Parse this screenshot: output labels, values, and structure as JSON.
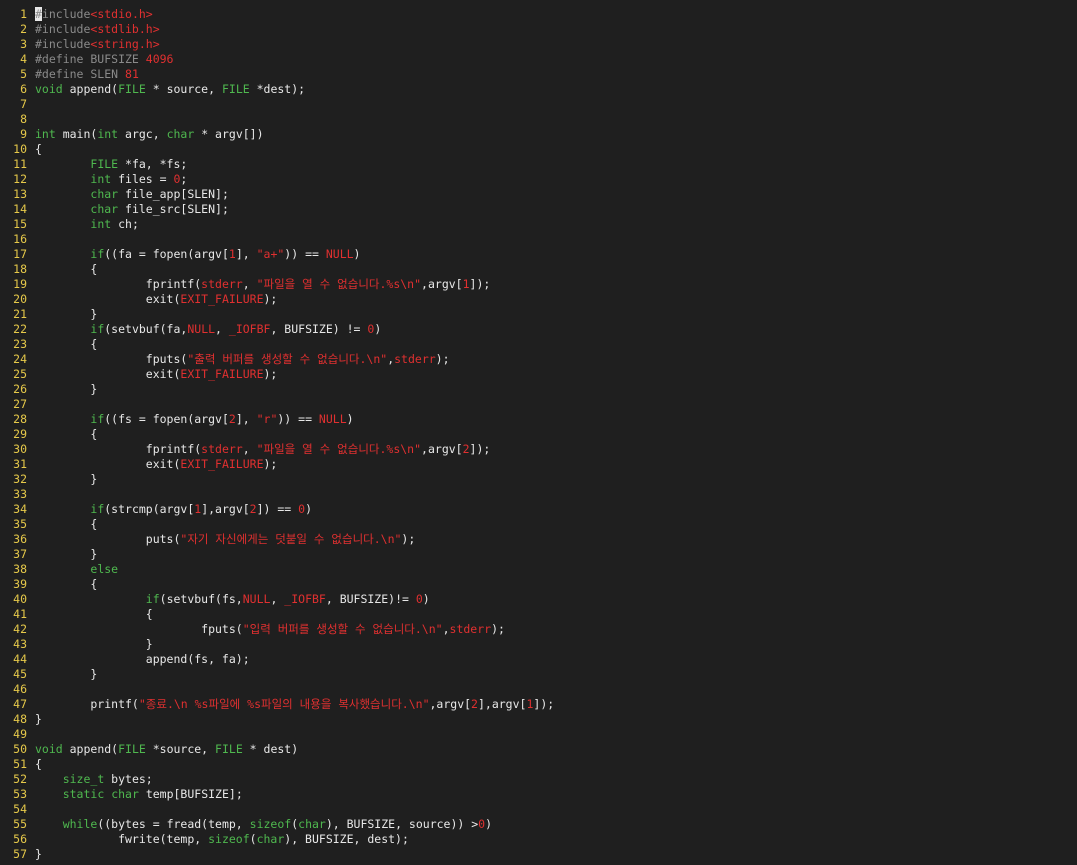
{
  "editor": {
    "cursor": {
      "line": 1,
      "col": 0
    },
    "colors": {
      "background": "#1f1f1f",
      "line_number": "#e6c94a",
      "plain": "#e8e8e8",
      "preprocessor": "#8a8a8a",
      "string_constant": "#e03030",
      "keyword_type": "#4fb84f"
    },
    "lines": [
      {
        "n": "1",
        "tokens": [
          [
            "pp",
            "#include"
          ],
          [
            "inc",
            "<stdio.h>"
          ]
        ]
      },
      {
        "n": "2",
        "tokens": [
          [
            "pp",
            "#include"
          ],
          [
            "inc",
            "<stdlib.h>"
          ]
        ]
      },
      {
        "n": "3",
        "tokens": [
          [
            "pp",
            "#include"
          ],
          [
            "inc",
            "<string.h>"
          ]
        ]
      },
      {
        "n": "4",
        "tokens": [
          [
            "pp",
            "#define BUFSIZE "
          ],
          [
            "num",
            "4096"
          ]
        ]
      },
      {
        "n": "5",
        "tokens": [
          [
            "pp",
            "#define SLEN "
          ],
          [
            "num",
            "81"
          ]
        ]
      },
      {
        "n": "6",
        "tokens": [
          [
            "kw",
            "void"
          ],
          [
            "plain",
            " append("
          ],
          [
            "type",
            "FILE"
          ],
          [
            "plain",
            " * source, "
          ],
          [
            "type",
            "FILE"
          ],
          [
            "plain",
            " *dest);"
          ]
        ]
      },
      {
        "n": "7",
        "tokens": []
      },
      {
        "n": "8",
        "tokens": []
      },
      {
        "n": "9",
        "tokens": [
          [
            "type",
            "int"
          ],
          [
            "plain",
            " main("
          ],
          [
            "type",
            "int"
          ],
          [
            "plain",
            " argc, "
          ],
          [
            "type",
            "char"
          ],
          [
            "plain",
            " * argv[])"
          ]
        ]
      },
      {
        "n": "10",
        "tokens": [
          [
            "plain",
            "{"
          ]
        ]
      },
      {
        "n": "11",
        "tokens": [
          [
            "plain",
            "        "
          ],
          [
            "type",
            "FILE"
          ],
          [
            "plain",
            " *fa, *fs;"
          ]
        ]
      },
      {
        "n": "12",
        "tokens": [
          [
            "plain",
            "        "
          ],
          [
            "type",
            "int"
          ],
          [
            "plain",
            " files = "
          ],
          [
            "num",
            "0"
          ],
          [
            "plain",
            ";"
          ]
        ]
      },
      {
        "n": "13",
        "tokens": [
          [
            "plain",
            "        "
          ],
          [
            "type",
            "char"
          ],
          [
            "plain",
            " file_app[SLEN];"
          ]
        ]
      },
      {
        "n": "14",
        "tokens": [
          [
            "plain",
            "        "
          ],
          [
            "type",
            "char"
          ],
          [
            "plain",
            " file_src[SLEN];"
          ]
        ]
      },
      {
        "n": "15",
        "tokens": [
          [
            "plain",
            "        "
          ],
          [
            "type",
            "int"
          ],
          [
            "plain",
            " ch;"
          ]
        ]
      },
      {
        "n": "16",
        "tokens": []
      },
      {
        "n": "17",
        "tokens": [
          [
            "plain",
            "        "
          ],
          [
            "kw",
            "if"
          ],
          [
            "plain",
            "((fa = fopen(argv["
          ],
          [
            "num",
            "1"
          ],
          [
            "plain",
            "], "
          ],
          [
            "str",
            "\"a+\""
          ],
          [
            "plain",
            ")) == "
          ],
          [
            "const",
            "NULL"
          ],
          [
            "plain",
            ")"
          ]
        ]
      },
      {
        "n": "18",
        "tokens": [
          [
            "plain",
            "        {"
          ]
        ]
      },
      {
        "n": "19",
        "tokens": [
          [
            "plain",
            "                fprintf("
          ],
          [
            "const",
            "stderr"
          ],
          [
            "plain",
            ", "
          ],
          [
            "str",
            "\"파일을 열 수 없습니다.%s\\n\""
          ],
          [
            "plain",
            ",argv["
          ],
          [
            "num",
            "1"
          ],
          [
            "plain",
            "]);"
          ]
        ]
      },
      {
        "n": "20",
        "tokens": [
          [
            "plain",
            "                exit("
          ],
          [
            "const",
            "EXIT_FAILURE"
          ],
          [
            "plain",
            ");"
          ]
        ]
      },
      {
        "n": "21",
        "tokens": [
          [
            "plain",
            "        }"
          ]
        ]
      },
      {
        "n": "22",
        "tokens": [
          [
            "plain",
            "        "
          ],
          [
            "kw",
            "if"
          ],
          [
            "plain",
            "(setvbuf(fa,"
          ],
          [
            "const",
            "NULL"
          ],
          [
            "plain",
            ", "
          ],
          [
            "const",
            "_IOFBF"
          ],
          [
            "plain",
            ", BUFSIZE) != "
          ],
          [
            "num",
            "0"
          ],
          [
            "plain",
            ")"
          ]
        ]
      },
      {
        "n": "23",
        "tokens": [
          [
            "plain",
            "        {"
          ]
        ]
      },
      {
        "n": "24",
        "tokens": [
          [
            "plain",
            "                fputs("
          ],
          [
            "str",
            "\"출력 버퍼를 생성할 수 없습니다.\\n\""
          ],
          [
            "plain",
            ","
          ],
          [
            "const",
            "stderr"
          ],
          [
            "plain",
            ");"
          ]
        ]
      },
      {
        "n": "25",
        "tokens": [
          [
            "plain",
            "                exit("
          ],
          [
            "const",
            "EXIT_FAILURE"
          ],
          [
            "plain",
            ");"
          ]
        ]
      },
      {
        "n": "26",
        "tokens": [
          [
            "plain",
            "        }"
          ]
        ]
      },
      {
        "n": "27",
        "tokens": []
      },
      {
        "n": "28",
        "tokens": [
          [
            "plain",
            "        "
          ],
          [
            "kw",
            "if"
          ],
          [
            "plain",
            "((fs = fopen(argv["
          ],
          [
            "num",
            "2"
          ],
          [
            "plain",
            "], "
          ],
          [
            "str",
            "\"r\""
          ],
          [
            "plain",
            ")) == "
          ],
          [
            "const",
            "NULL"
          ],
          [
            "plain",
            ")"
          ]
        ]
      },
      {
        "n": "29",
        "tokens": [
          [
            "plain",
            "        {"
          ]
        ]
      },
      {
        "n": "30",
        "tokens": [
          [
            "plain",
            "                fprintf("
          ],
          [
            "const",
            "stderr"
          ],
          [
            "plain",
            ", "
          ],
          [
            "str",
            "\"파일을 열 수 없습니다.%s\\n\""
          ],
          [
            "plain",
            ",argv["
          ],
          [
            "num",
            "2"
          ],
          [
            "plain",
            "]);"
          ]
        ]
      },
      {
        "n": "31",
        "tokens": [
          [
            "plain",
            "                exit("
          ],
          [
            "const",
            "EXIT_FAILURE"
          ],
          [
            "plain",
            ");"
          ]
        ]
      },
      {
        "n": "32",
        "tokens": [
          [
            "plain",
            "        }"
          ]
        ]
      },
      {
        "n": "33",
        "tokens": []
      },
      {
        "n": "34",
        "tokens": [
          [
            "plain",
            "        "
          ],
          [
            "kw",
            "if"
          ],
          [
            "plain",
            "(strcmp(argv["
          ],
          [
            "num",
            "1"
          ],
          [
            "plain",
            "],argv["
          ],
          [
            "num",
            "2"
          ],
          [
            "plain",
            "]) == "
          ],
          [
            "num",
            "0"
          ],
          [
            "plain",
            ")"
          ]
        ]
      },
      {
        "n": "35",
        "tokens": [
          [
            "plain",
            "        {"
          ]
        ]
      },
      {
        "n": "36",
        "tokens": [
          [
            "plain",
            "                puts("
          ],
          [
            "str",
            "\"자기 자신에게는 덧붙일 수 없습니다.\\n\""
          ],
          [
            "plain",
            ");"
          ]
        ]
      },
      {
        "n": "37",
        "tokens": [
          [
            "plain",
            "        }"
          ]
        ]
      },
      {
        "n": "38",
        "tokens": [
          [
            "plain",
            "        "
          ],
          [
            "kw",
            "else"
          ]
        ]
      },
      {
        "n": "39",
        "tokens": [
          [
            "plain",
            "        {"
          ]
        ]
      },
      {
        "n": "40",
        "tokens": [
          [
            "plain",
            "                "
          ],
          [
            "kw",
            "if"
          ],
          [
            "plain",
            "(setvbuf(fs,"
          ],
          [
            "const",
            "NULL"
          ],
          [
            "plain",
            ", "
          ],
          [
            "const",
            "_IOFBF"
          ],
          [
            "plain",
            ", BUFSIZE)!= "
          ],
          [
            "num",
            "0"
          ],
          [
            "plain",
            ")"
          ]
        ]
      },
      {
        "n": "41",
        "tokens": [
          [
            "plain",
            "                {"
          ]
        ]
      },
      {
        "n": "42",
        "tokens": [
          [
            "plain",
            "                        fputs("
          ],
          [
            "str",
            "\"입력 버퍼를 생성할 수 없습니다.\\n\""
          ],
          [
            "plain",
            ","
          ],
          [
            "const",
            "stderr"
          ],
          [
            "plain",
            ");"
          ]
        ]
      },
      {
        "n": "43",
        "tokens": [
          [
            "plain",
            "                }"
          ]
        ]
      },
      {
        "n": "44",
        "tokens": [
          [
            "plain",
            "                append(fs, fa);"
          ]
        ]
      },
      {
        "n": "45",
        "tokens": [
          [
            "plain",
            "        }"
          ]
        ]
      },
      {
        "n": "46",
        "tokens": []
      },
      {
        "n": "47",
        "tokens": [
          [
            "plain",
            "        printf("
          ],
          [
            "str",
            "\"종료.\\n %s파일에 %s파일의 내용을 복사했습니다.\\n\""
          ],
          [
            "plain",
            ",argv["
          ],
          [
            "num",
            "2"
          ],
          [
            "plain",
            "],argv["
          ],
          [
            "num",
            "1"
          ],
          [
            "plain",
            "]);"
          ]
        ]
      },
      {
        "n": "48",
        "tokens": [
          [
            "plain",
            "}"
          ]
        ]
      },
      {
        "n": "49",
        "tokens": []
      },
      {
        "n": "50",
        "tokens": [
          [
            "kw",
            "void"
          ],
          [
            "plain",
            " append("
          ],
          [
            "type",
            "FILE"
          ],
          [
            "plain",
            " *source, "
          ],
          [
            "type",
            "FILE"
          ],
          [
            "plain",
            " * dest)"
          ]
        ]
      },
      {
        "n": "51",
        "tokens": [
          [
            "plain",
            "{"
          ]
        ]
      },
      {
        "n": "52",
        "tokens": [
          [
            "plain",
            "    "
          ],
          [
            "type",
            "size_t"
          ],
          [
            "plain",
            " bytes;"
          ]
        ]
      },
      {
        "n": "53",
        "tokens": [
          [
            "plain",
            "    "
          ],
          [
            "kw",
            "static"
          ],
          [
            "plain",
            " "
          ],
          [
            "type",
            "char"
          ],
          [
            "plain",
            " temp[BUFSIZE];"
          ]
        ]
      },
      {
        "n": "54",
        "tokens": []
      },
      {
        "n": "55",
        "tokens": [
          [
            "plain",
            "    "
          ],
          [
            "kw",
            "while"
          ],
          [
            "plain",
            "((bytes = fread(temp, "
          ],
          [
            "kw",
            "sizeof"
          ],
          [
            "plain",
            "("
          ],
          [
            "type",
            "char"
          ],
          [
            "plain",
            "), BUFSIZE, source)) >"
          ],
          [
            "num",
            "0"
          ],
          [
            "plain",
            ")"
          ]
        ]
      },
      {
        "n": "56",
        "tokens": [
          [
            "plain",
            "            fwrite(temp, "
          ],
          [
            "kw",
            "sizeof"
          ],
          [
            "plain",
            "("
          ],
          [
            "type",
            "char"
          ],
          [
            "plain",
            "), BUFSIZE, dest);"
          ]
        ]
      },
      {
        "n": "57",
        "tokens": [
          [
            "plain",
            "}"
          ]
        ]
      }
    ]
  }
}
